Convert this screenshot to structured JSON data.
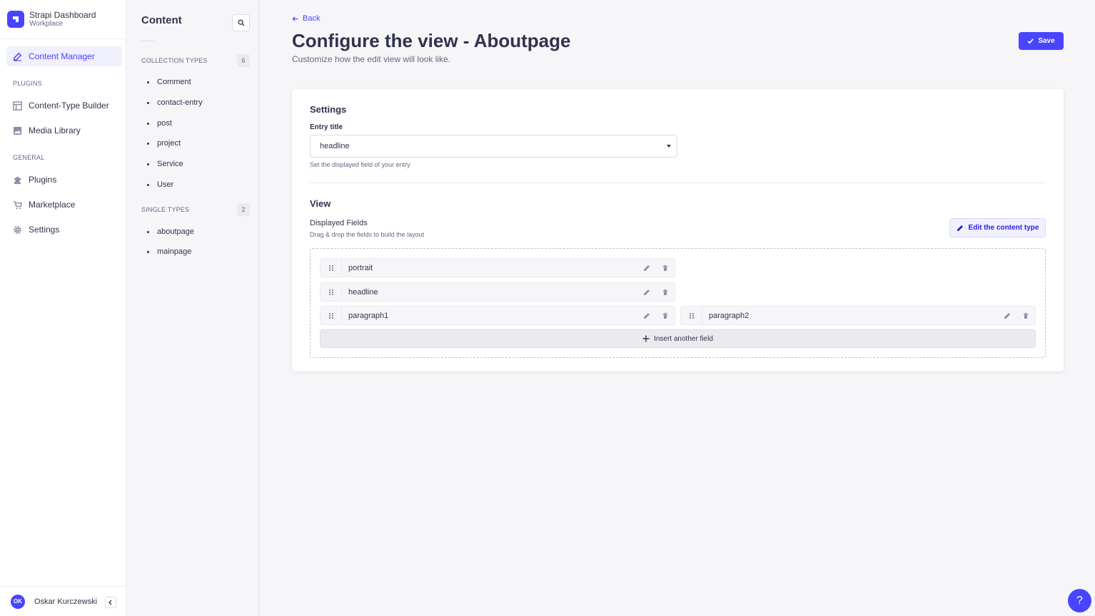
{
  "brand": {
    "title": "Strapi Dashboard",
    "subtitle": "Workplace"
  },
  "mainnav": {
    "active_item": "Content Manager",
    "plugins_label": "PLUGINS",
    "plugins": [
      "Content-Type Builder",
      "Media Library"
    ],
    "general_label": "GENERAL",
    "general": [
      "Plugins",
      "Marketplace",
      "Settings"
    ]
  },
  "user": {
    "initials": "OK",
    "name": "Oskar Kurczewski"
  },
  "subnav": {
    "title": "Content",
    "collection_label": "COLLECTION TYPES",
    "collection_count": "6",
    "collection_items": [
      "Comment",
      "contact-entry",
      "post",
      "project",
      "Service",
      "User"
    ],
    "single_label": "SINGLE TYPES",
    "single_count": "2",
    "single_items": [
      "aboutpage",
      "mainpage"
    ]
  },
  "header": {
    "back": "Back",
    "title": "Configure the view - Aboutpage",
    "subtitle": "Customize how the edit view will look like.",
    "save": "Save"
  },
  "settings": {
    "heading": "Settings",
    "entry_title_label": "Entry title",
    "entry_title_value": "headline",
    "entry_title_hint": "Set the displayed field of your entry"
  },
  "view": {
    "heading": "View",
    "displayed_label": "Displayed Fields",
    "displayed_hint": "Drag & drop the fields to build the layout",
    "edit_ct": "Edit the content type",
    "fields": [
      "portrait",
      "headline",
      "paragraph1",
      "paragraph2"
    ],
    "insert": "Insert another field"
  },
  "help": "?",
  "colors": {
    "accent": "#4945ff",
    "background": "#f6f6f9",
    "text": "#32324d",
    "muted": "#666687"
  }
}
